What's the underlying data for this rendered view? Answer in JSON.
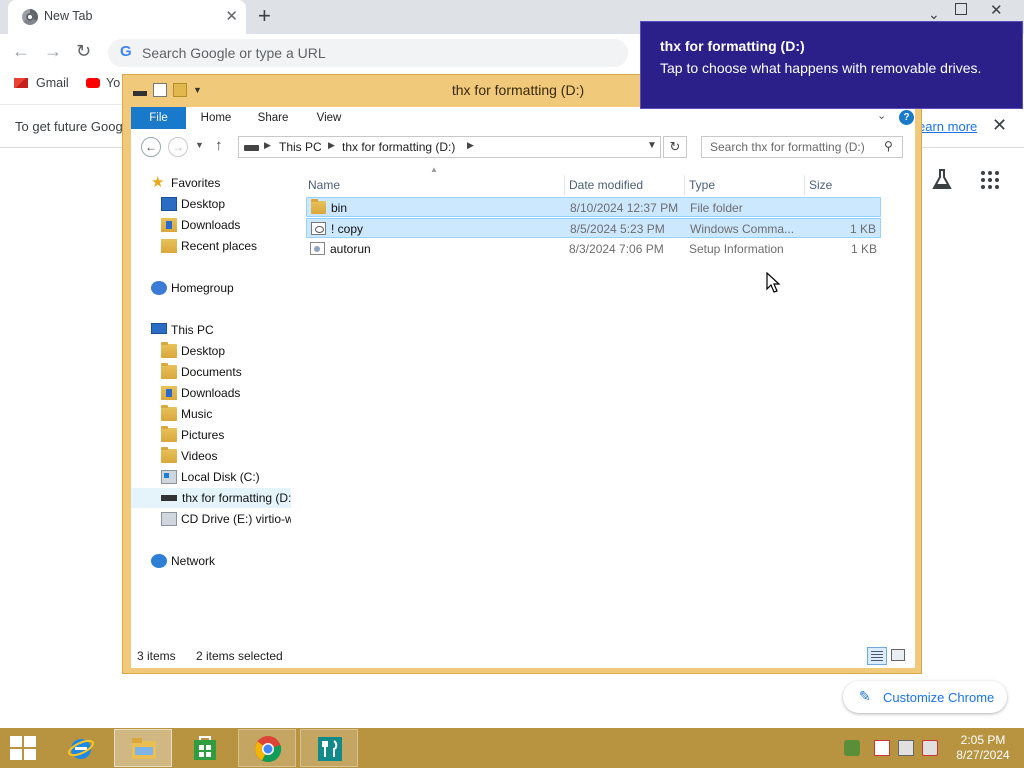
{
  "colors": {
    "toast_bg": "#2b1f8a",
    "explorer_frame": "#f0c97a",
    "ribbon_file_tab": "#1979ca",
    "selection": "#cce8ff",
    "taskbar": "#b89340",
    "link": "#1a73e8"
  },
  "chrome": {
    "tab_title": "New Tab",
    "omnibox_placeholder": "Search Google or type a URL",
    "bookmarks": [
      {
        "label": "Gmail",
        "icon": "gmail-icon"
      },
      {
        "label": "Yo",
        "icon": "youtube-icon"
      }
    ],
    "info_bar_text": "To get future Goog",
    "info_bar_link": "earn more",
    "customize_label": "Customize Chrome"
  },
  "toast": {
    "title": "thx for formatting (D:)",
    "message": "Tap to choose what happens with removable drives."
  },
  "explorer": {
    "title": "thx for formatting (D:)",
    "ribbon_tabs": [
      "File",
      "Home",
      "Share",
      "View"
    ],
    "breadcrumb": [
      "This PC",
      "thx for formatting (D:)"
    ],
    "search_placeholder": "Search thx for formatting (D:)",
    "nav": {
      "favorites_label": "Favorites",
      "favorites": [
        "Desktop",
        "Downloads",
        "Recent places"
      ],
      "homegroup": "Homegroup",
      "this_pc_label": "This PC",
      "this_pc": [
        "Desktop",
        "Documents",
        "Downloads",
        "Music",
        "Pictures",
        "Videos",
        "Local Disk (C:)",
        "thx for formatting (D:)",
        "CD Drive (E:) virtio-win"
      ],
      "network": "Network"
    },
    "columns": [
      "Name",
      "Date modified",
      "Type",
      "Size"
    ],
    "files": [
      {
        "name": "bin",
        "date": "8/10/2024 12:37 PM",
        "type": "File folder",
        "size": "",
        "selected": true,
        "icon": "folder-icon"
      },
      {
        "name": "! copy",
        "date": "8/5/2024 5:23 PM",
        "type": "Windows Comma...",
        "size": "1 KB",
        "selected": true,
        "icon": "batch-file-icon"
      },
      {
        "name": "autorun",
        "date": "8/3/2024 7:06 PM",
        "type": "Setup Information",
        "size": "1 KB",
        "selected": false,
        "icon": "setup-info-icon"
      }
    ],
    "status_count": "3 items",
    "status_selected": "2 items selected"
  },
  "taskbar": {
    "apps": [
      "internet-explorer-icon",
      "file-explorer-icon",
      "store-icon",
      "chrome-icon",
      "app-icon"
    ],
    "time": "2:05 PM",
    "date": "8/27/2024"
  }
}
